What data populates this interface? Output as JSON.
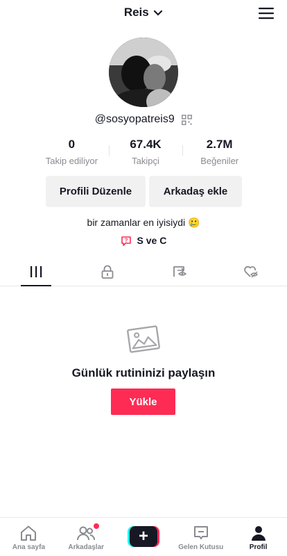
{
  "header": {
    "username": "Reis",
    "icons": {
      "dropdown": "chevron-down-icon",
      "menu": "hamburger-menu-icon"
    }
  },
  "profile": {
    "handle": "@sosyopatreis9",
    "stats": [
      {
        "value": "0",
        "label": "Takip ediliyor"
      },
      {
        "value": "67.4K",
        "label": "Takipçi"
      },
      {
        "value": "2.7M",
        "label": "Beğeniler"
      }
    ],
    "edit_button": "Profili Düzenle",
    "add_friend_button": "Arkadaş ekle",
    "bio": "bir zamanlar en iyisiydi 🥲",
    "link": "S ve C"
  },
  "tabs": [
    {
      "icon": "grid-icon",
      "active": true
    },
    {
      "icon": "lock-icon",
      "active": false
    },
    {
      "icon": "repost-icon",
      "active": false
    },
    {
      "icon": "liked-hidden-icon",
      "active": false
    }
  ],
  "empty_state": {
    "message": "Günlük rutininizi paylaşın",
    "upload_button": "Yükle"
  },
  "bottom_nav": [
    {
      "label": "Ana sayfa",
      "icon": "home-icon"
    },
    {
      "label": "Arkadaşlar",
      "icon": "friends-icon",
      "notification": true
    },
    {
      "label": "",
      "icon": "create-plus-icon"
    },
    {
      "label": "Gelen Kutusu",
      "icon": "inbox-icon"
    },
    {
      "label": "Profil",
      "icon": "profile-icon",
      "active": true
    }
  ],
  "colors": {
    "accent": "#fe2c55",
    "text": "#161823",
    "muted": "#8a8b91",
    "button_bg": "#f1f1f2"
  }
}
